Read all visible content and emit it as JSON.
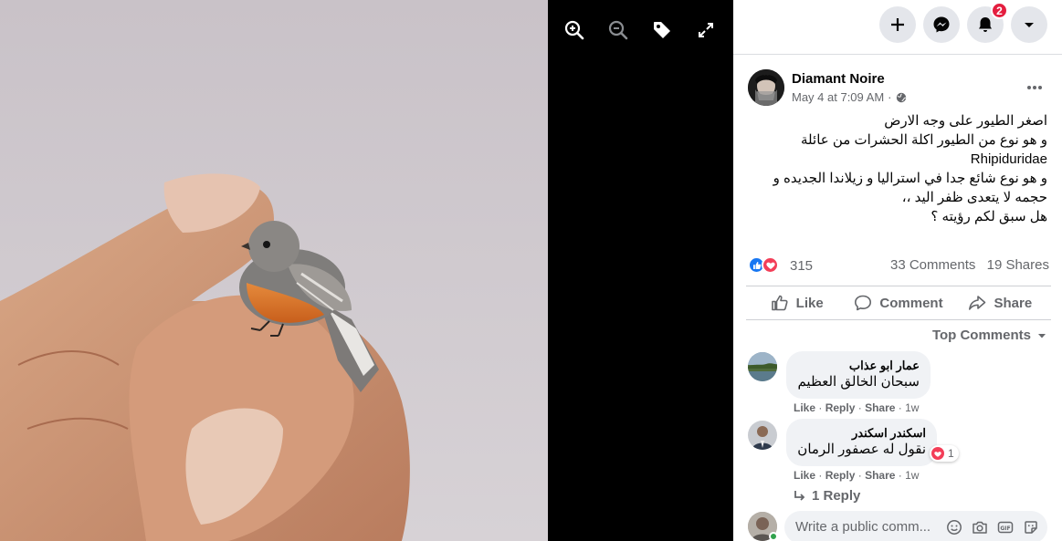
{
  "topbar": {
    "create_icon": "plus-icon",
    "messenger_icon": "messenger-icon",
    "notifications_icon": "bell-icon",
    "notifications_badge": "2",
    "account_icon": "caret-down-icon"
  },
  "viewer": {
    "controls": [
      "zoom-in-icon",
      "zoom-out-icon",
      "tag-icon",
      "fullscreen-icon"
    ],
    "background": "#000000"
  },
  "post": {
    "author": "Diamant Noire",
    "timestamp": "May 4 at 7:09 AM",
    "separator": "·",
    "privacy_icon": "globe-icon",
    "text_lines": [
      "اصغر الطيور على وجه الارض",
      "و هو نوع من الطيور اكلة الحشرات من عائلة",
      "Rhipiduridae",
      "و هو نوع شائع جدا في استراليا و زيلاندا الجديده و",
      "حجمه لا يتعدى ظفر اليد ،،",
      "هل سبق لكم رؤيته ؟"
    ],
    "reaction_count": "315",
    "comments_count": "33 Comments",
    "shares_count": "19 Shares",
    "actions": {
      "like": "Like",
      "comment": "Comment",
      "share": "Share"
    },
    "sort_label": "Top Comments"
  },
  "comments": [
    {
      "name": "عمار ابو عذاب",
      "text": "سبحان الخالق العظيم",
      "like": "Like",
      "reply": "Reply",
      "share": "Share",
      "sep": "·",
      "time": "1w"
    },
    {
      "name": "اسكندر اسكندر",
      "text": "نقول له عصفور الرمان",
      "reaction_count": "1",
      "like": "Like",
      "reply": "Reply",
      "share": "Share",
      "sep": "·",
      "time": "1w",
      "replies_label": "1 Reply"
    }
  ],
  "composer": {
    "placeholder": "Write a public comm..."
  },
  "colors": {
    "accent": "#1877f2",
    "badge": "#e41e3f",
    "secondary_text": "#65676b",
    "bubble": "#f0f2f5"
  }
}
